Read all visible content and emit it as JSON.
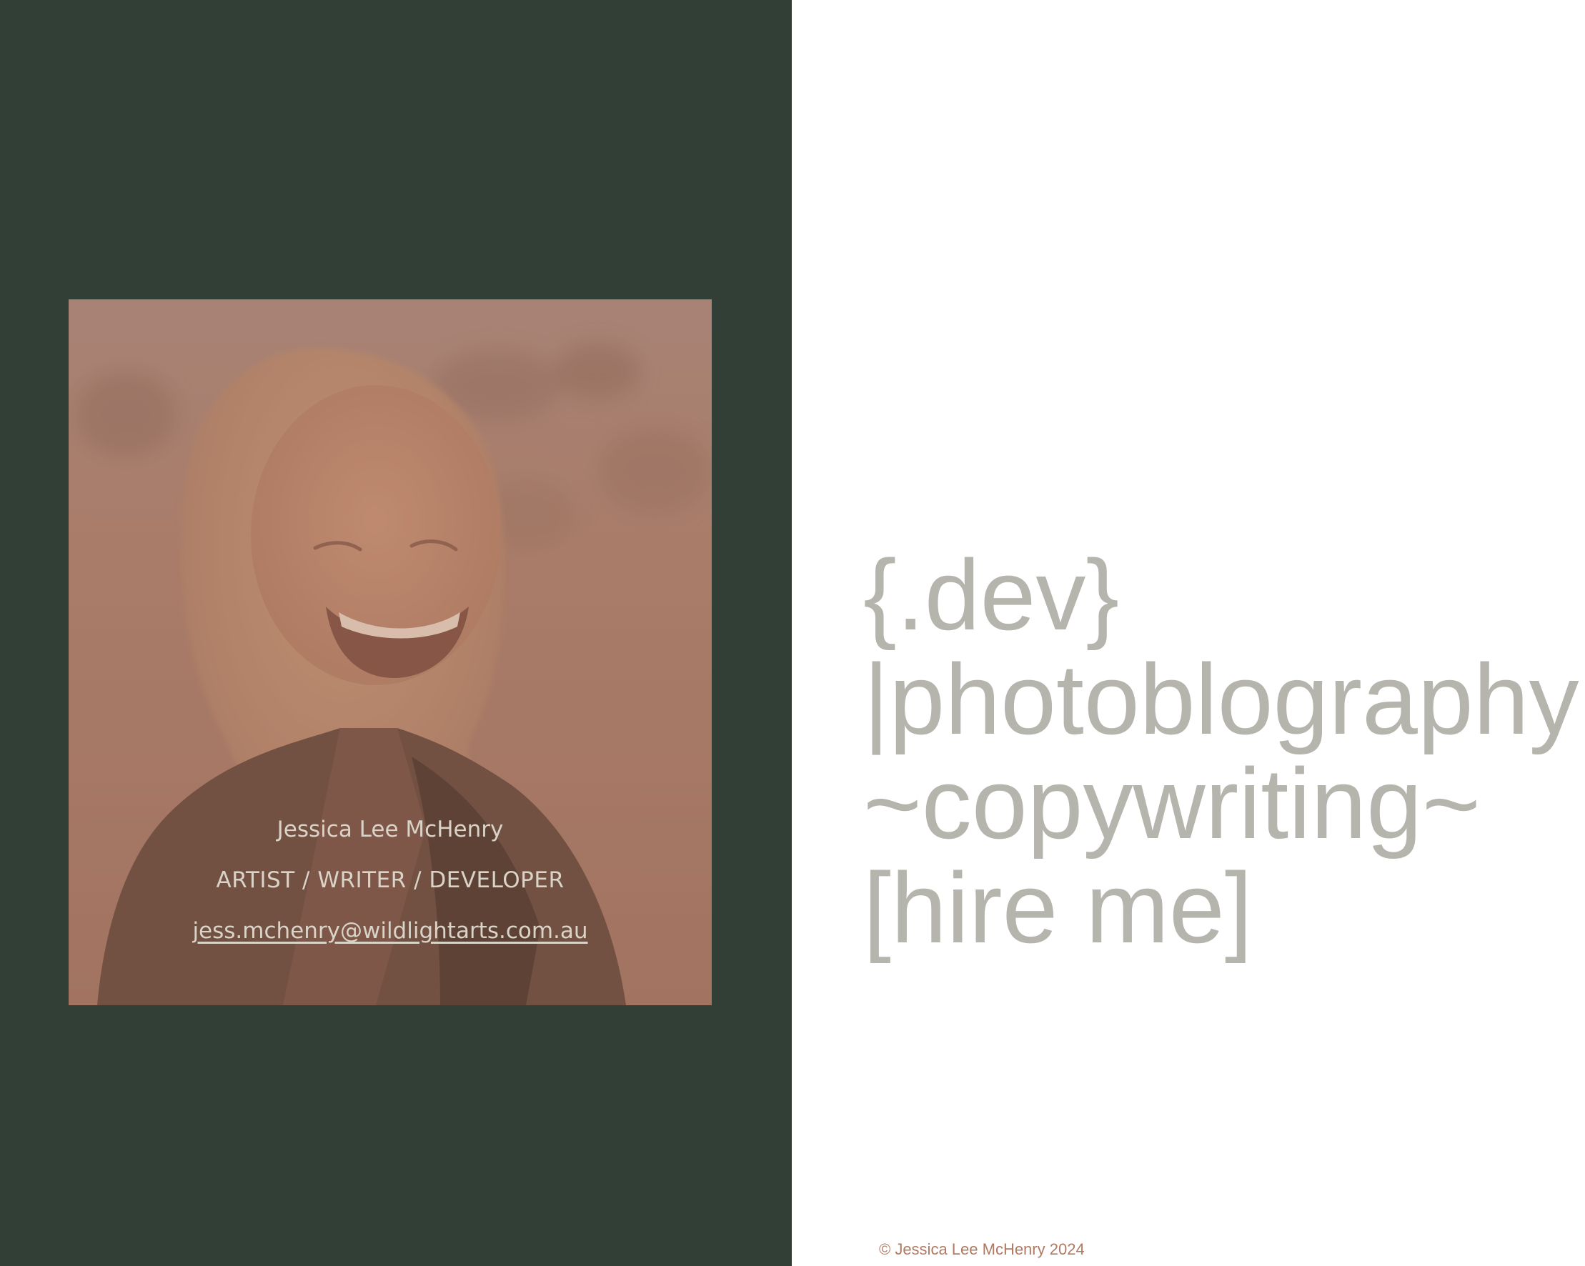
{
  "profile": {
    "name": "Jessica Lee McHenry",
    "roles": "ARTIST / WRITER / DEVELOPER",
    "email": "jess.mchenry@wildlightarts.com.au"
  },
  "services": {
    "dev": "{.dev}",
    "photoblography": "|photoblography|",
    "copywriting": "~copywriting~",
    "hire": "[hire me]"
  },
  "footer": {
    "copyright": "© Jessica Lee McHenry 2024"
  },
  "colors": {
    "left_panel_bg": "#323f36",
    "card_tint": "#a78578",
    "service_text": "#b5b5ae",
    "footer_text": "#b07a62",
    "card_text": "#d9d3c8"
  }
}
